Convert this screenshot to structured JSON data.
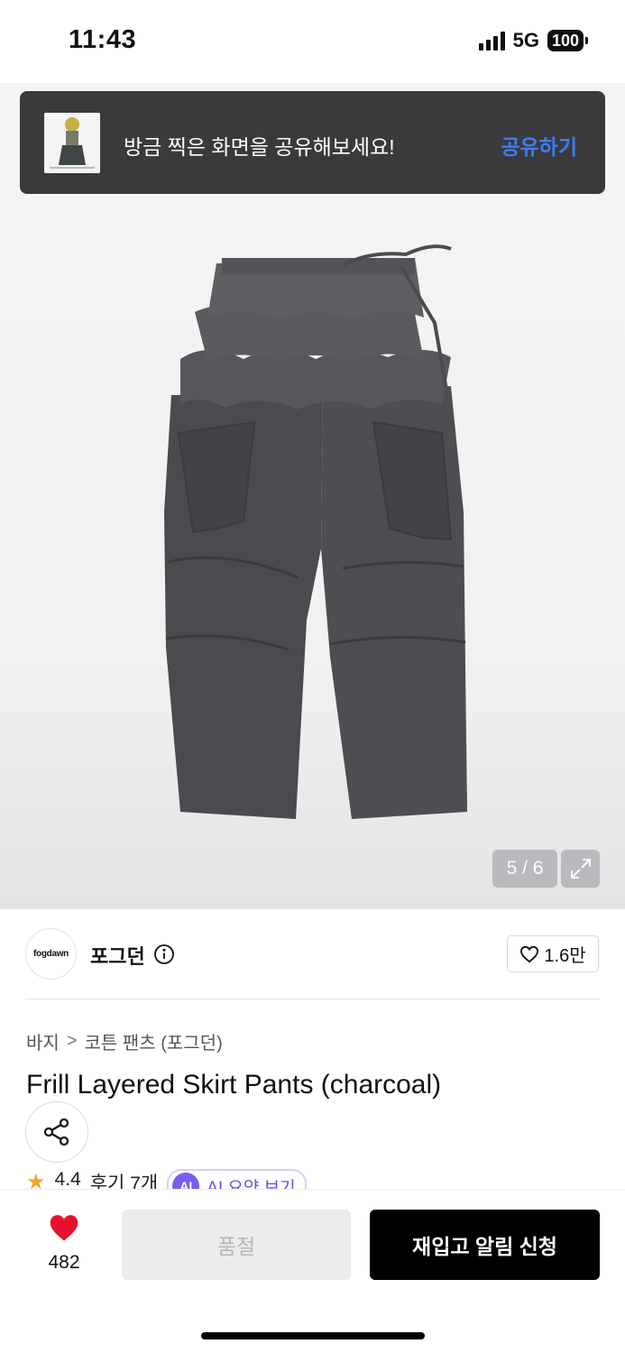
{
  "status_bar": {
    "time": "11:43",
    "network": "5G",
    "battery": "100"
  },
  "toast": {
    "message": "방금 찍은 화면을 공유해보세요!",
    "action_label": "공유하기",
    "action_color": "#3d7cf5"
  },
  "gallery": {
    "counter": "5 / 6",
    "expand_icon": "expand-icon"
  },
  "brand": {
    "logo_text": "fogdawn",
    "name": "포그던",
    "info_icon": "info-icon",
    "like_count": "1.6만"
  },
  "breadcrumb": {
    "items": [
      "바지",
      "코튼 팬츠 (포그던)"
    ],
    "separator": ">"
  },
  "product": {
    "title": "Frill Layered Skirt Pants (charcoal)",
    "rating": "4.4",
    "reviews": "후기 7개",
    "ai_badge": "AI",
    "ai_summary_label": "AI 요약 보기"
  },
  "bottom_bar": {
    "wish_count": "482",
    "soldout_label": "품절",
    "restock_label": "재입고 알림 신청",
    "heart_color": "#e8112d"
  }
}
